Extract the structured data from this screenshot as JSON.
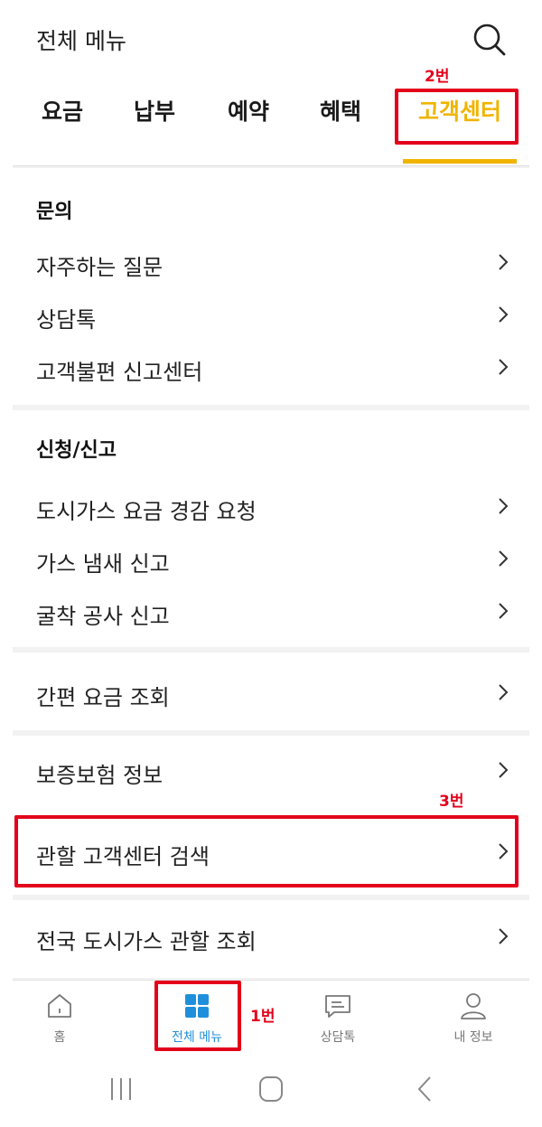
{
  "header": {
    "title": "전체 메뉴",
    "search_icon": "search-icon"
  },
  "tabs": [
    {
      "label": "요금",
      "active": false
    },
    {
      "label": "납부",
      "active": false
    },
    {
      "label": "예약",
      "active": false
    },
    {
      "label": "혜택",
      "active": false
    },
    {
      "label": "고객센터",
      "active": true
    }
  ],
  "sections": {
    "inquiry": {
      "title": "문의",
      "items": [
        "자주하는 질문",
        "상담톡",
        "고객불편 신고센터"
      ]
    },
    "apply": {
      "title": "신청/신고",
      "items": [
        "도시가스 요금 경감 요청",
        "가스 냄새 신고",
        "굴착 공사 신고"
      ]
    },
    "single_items": [
      "간편 요금 조회",
      "보증보험 정보",
      "관할 고객센터 검색",
      "전국 도시가스 관할 조회"
    ]
  },
  "annotations": {
    "label1": "1번",
    "label2": "2번",
    "label3": "3번"
  },
  "bottom_nav": [
    {
      "label": "홈",
      "icon": "home-icon",
      "active": false
    },
    {
      "label": "전체 메뉴",
      "icon": "grid-icon",
      "active": true
    },
    {
      "label": "상담톡",
      "icon": "chat-icon",
      "active": false
    },
    {
      "label": "내 정보",
      "icon": "user-icon",
      "active": false
    }
  ],
  "colors": {
    "accent": "#f0b400",
    "nav_active": "#1f8fdc",
    "annotation": "#e3001b"
  }
}
